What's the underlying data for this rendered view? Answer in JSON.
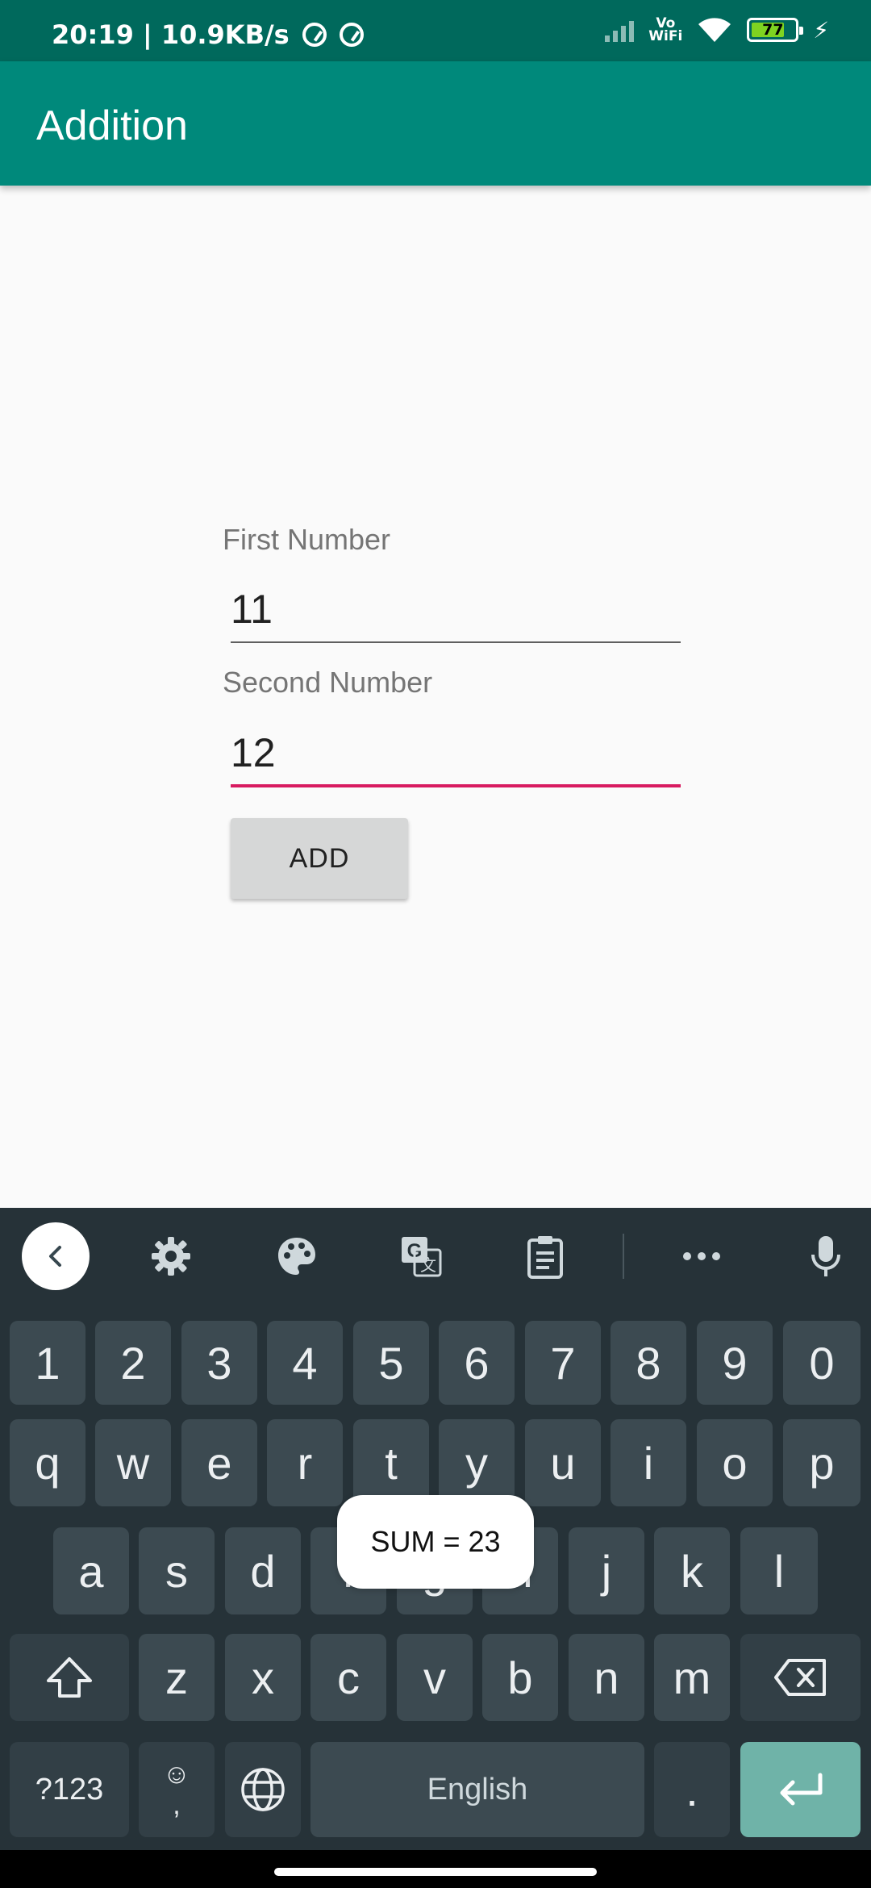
{
  "status_bar": {
    "time_speed": "20:19 | 10.9KB/s",
    "vowifi_top": "Vo",
    "vowifi_bottom": "WiFi",
    "battery": "77",
    "charging_icon": "lightning-bolt-icon",
    "battery_level_percent": 77,
    "colors": {
      "background": "#00695c",
      "battery_fill": "#7ed321"
    }
  },
  "app_bar": {
    "title": "Addition",
    "color": "#00897b"
  },
  "form": {
    "first_label": "First Number",
    "first_value": "11",
    "second_label": "Second Number",
    "second_value": "12",
    "add_label": "ADD",
    "focus_color": "#d81b60"
  },
  "toast": {
    "text": "SUM = 23"
  },
  "keyboard": {
    "toolbar_icons": [
      "back-icon",
      "gear-icon",
      "palette-icon",
      "translate-icon",
      "clipboard-icon",
      "more-icon",
      "microphone-icon"
    ],
    "number_row": [
      "1",
      "2",
      "3",
      "4",
      "5",
      "6",
      "7",
      "8",
      "9",
      "0"
    ],
    "row1": [
      "q",
      "w",
      "e",
      "r",
      "t",
      "y",
      "u",
      "i",
      "o",
      "p"
    ],
    "row2": [
      "a",
      "s",
      "d",
      "f",
      "g",
      "h",
      "j",
      "k",
      "l"
    ],
    "row3": [
      "z",
      "x",
      "c",
      "v",
      "b",
      "n",
      "m"
    ],
    "symbols_label": "?123",
    "emoji_top": "☺",
    "emoji_bottom": ",",
    "space_label": "English",
    "period_label": ".",
    "colors": {
      "background": "#263238",
      "key": "#3c4a51",
      "enter": "#6fb3a8"
    }
  }
}
